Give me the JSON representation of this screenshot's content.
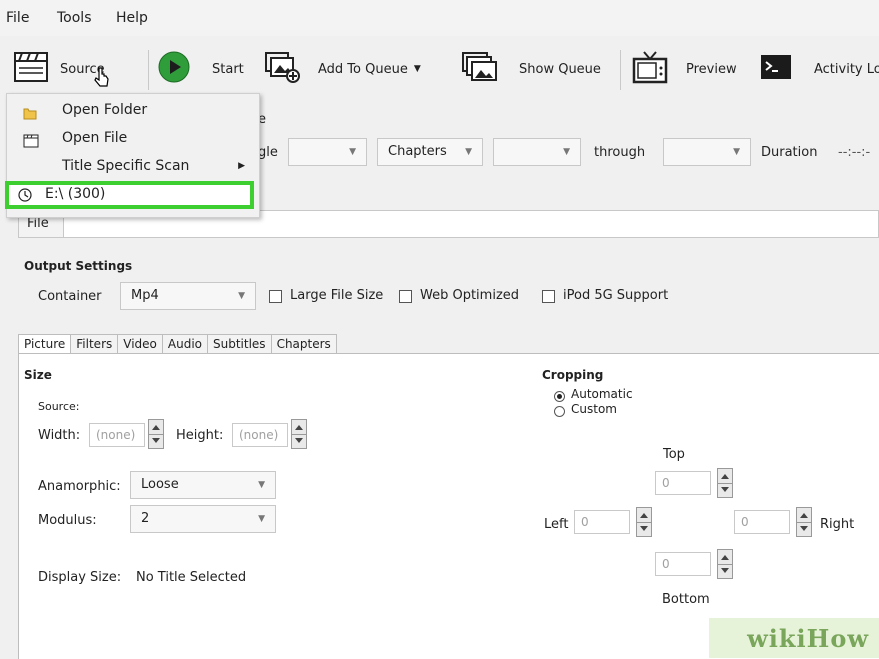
{
  "menubar": {
    "file": "File",
    "tools": "Tools",
    "help": "Help"
  },
  "toolbar": {
    "source": "Source",
    "start": "Start",
    "add_to_queue": "Add To Queue",
    "show_queue": "Show Queue",
    "preview": "Preview",
    "activity_log": "Activity Lo"
  },
  "source_menu": {
    "open_folder": "Open Folder",
    "open_file": "Open File",
    "title_specific_scan": "Title Specific Scan",
    "drive": "E:\\ (300)"
  },
  "source_row": {
    "partial_title": "e",
    "angle_partial": "gle",
    "chapters": "Chapters",
    "through": "through",
    "duration_label": "Duration",
    "duration_value": "--:--:-"
  },
  "destination": {
    "file_tab": "File"
  },
  "output_settings": {
    "title": "Output Settings",
    "container_label": "Container",
    "container_value": "Mp4",
    "large_file_size": "Large File Size",
    "web_optimized": "Web Optimized",
    "ipod": "iPod 5G Support"
  },
  "tabs": [
    "Picture",
    "Filters",
    "Video",
    "Audio",
    "Subtitles",
    "Chapters"
  ],
  "picture": {
    "size_title": "Size",
    "source_label": "Source:",
    "width_label": "Width:",
    "width_value": "(none)",
    "height_label": "Height:",
    "height_value": "(none)",
    "anamorphic_label": "Anamorphic:",
    "anamorphic_value": "Loose",
    "modulus_label": "Modulus:",
    "modulus_value": "2",
    "display_size_label": "Display Size:",
    "display_size_value": "No Title Selected"
  },
  "cropping": {
    "title": "Cropping",
    "automatic": "Automatic",
    "custom": "Custom",
    "top": "Top",
    "left": "Left",
    "right": "Right",
    "bottom": "Bottom",
    "top_value": "0",
    "left_value": "0",
    "right_value": "0",
    "bottom_value": "0"
  },
  "watermark": "wikiHow"
}
